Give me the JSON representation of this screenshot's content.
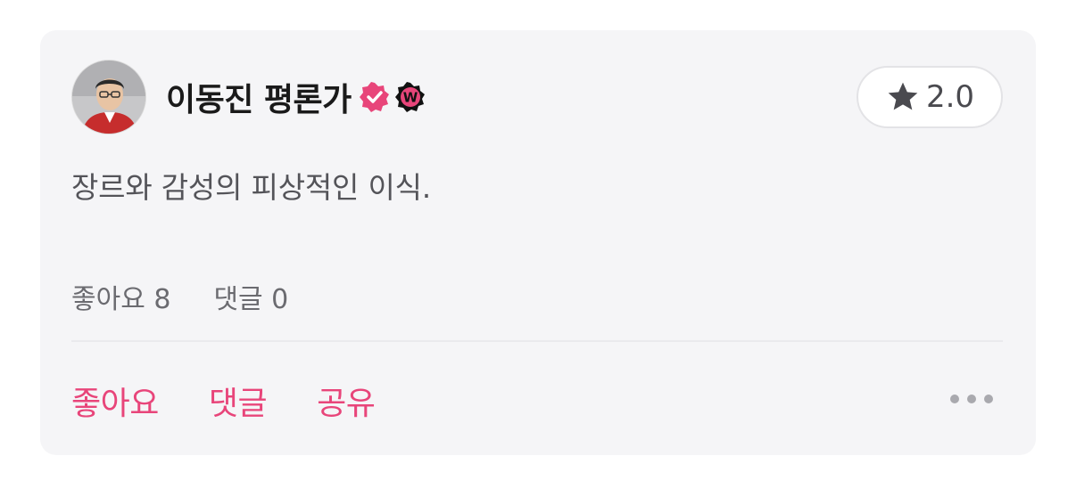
{
  "review": {
    "author": {
      "name": "이동진 평론가",
      "avatar_icon": "avatar",
      "badges": [
        {
          "icon": "verified-icon",
          "color": "#e8457a"
        },
        {
          "icon": "watcha-w-badge-icon",
          "color": "#111111",
          "text": "W"
        }
      ]
    },
    "rating": {
      "value": "2.0",
      "icon": "star-icon",
      "color": "#4a4a4f"
    },
    "comment": "장르와 감성의 피상적인 이식.",
    "stats": {
      "likes": "좋아요 8",
      "comments": "댓글 0"
    },
    "actions": {
      "like": "좋아요",
      "comment": "댓글",
      "share": "공유",
      "more_icon": "more-dots-icon"
    },
    "colors": {
      "accent": "#e8457a",
      "card_bg": "#f5f5f7"
    }
  }
}
